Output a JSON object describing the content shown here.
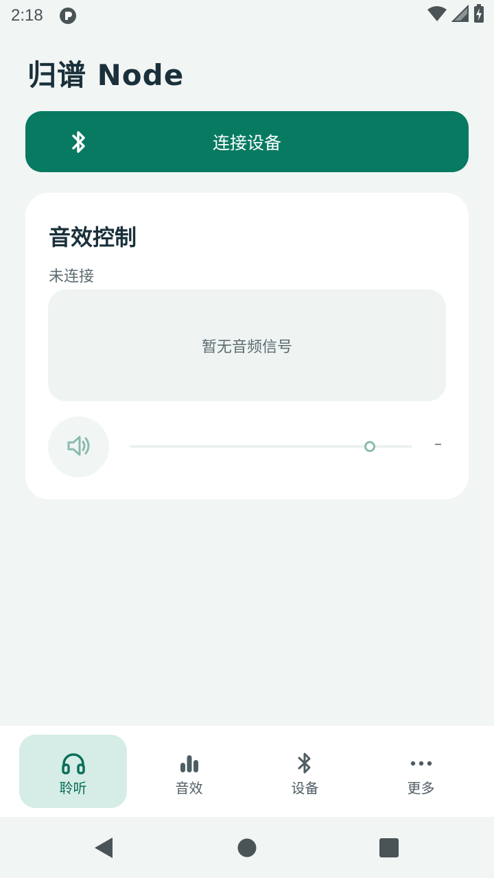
{
  "status_bar": {
    "time": "2:18",
    "icons": [
      "app-notification-icon",
      "wifi-icon",
      "cellular-signal-icon",
      "battery-charging-icon"
    ]
  },
  "header": {
    "title": "归谱 Node"
  },
  "connect": {
    "icon": "bluetooth-icon",
    "label": "连接设备"
  },
  "audio_card": {
    "title": "音效控制",
    "status": "未连接",
    "signal_placeholder": "暂无音频信号",
    "volume": {
      "icon": "volume-icon",
      "level": 0.85,
      "value_label": "–"
    }
  },
  "bottom_nav": {
    "items": [
      {
        "label": "聆听",
        "icon": "headphones-icon",
        "active": true
      },
      {
        "label": "音效",
        "icon": "bar-chart-icon",
        "active": false
      },
      {
        "label": "设备",
        "icon": "bluetooth-icon",
        "active": false
      },
      {
        "label": "更多",
        "icon": "more-horizontal-icon",
        "active": false
      }
    ]
  },
  "system_nav": {
    "icons": [
      "back-icon",
      "home-icon",
      "recents-icon"
    ]
  },
  "colors": {
    "background": "#f1f5f4",
    "accent": "#087a62",
    "card": "#ffffff",
    "nav_active_bg": "#d5ede6",
    "text_primary": "#1a303a",
    "text_secondary": "#5d6b70"
  }
}
